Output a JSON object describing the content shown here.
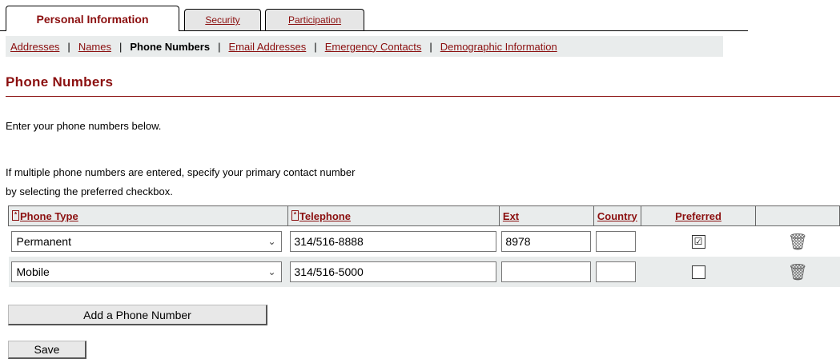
{
  "tabs": {
    "personal": "Personal Information",
    "security": "Security",
    "participation": "Participation"
  },
  "subnav": {
    "addresses": "Addresses",
    "names": "Names",
    "phone_numbers": "Phone Numbers",
    "email_addresses": "Email Addresses",
    "emergency_contacts": "Emergency Contacts",
    "demographic": "Demographic Information",
    "separator": "|"
  },
  "page": {
    "title": "Phone Numbers",
    "instruction": "Enter your phone numbers below.",
    "multi_line1": "If multiple phone numbers are entered, specify your primary contact number",
    "multi_line2": "by selecting the preferred checkbox."
  },
  "table": {
    "required_marker": "*",
    "headers": {
      "phone_type": "Phone Type",
      "telephone": "Telephone",
      "ext": "Ext",
      "country": "Country",
      "preferred": "Preferred"
    },
    "rows": [
      {
        "phone_type": "Permanent",
        "telephone": "314/516-8888",
        "ext": "8978",
        "country": "",
        "preferred": "☑"
      },
      {
        "phone_type": "Mobile",
        "telephone": "314/516-5000",
        "ext": "",
        "country": "",
        "preferred": ""
      }
    ],
    "delete_icon": "trash-icon"
  },
  "buttons": {
    "add_phone": "Add a Phone Number",
    "save": "Save"
  },
  "colors": {
    "accent": "#8b0f0f",
    "band": "#e9ecec"
  }
}
